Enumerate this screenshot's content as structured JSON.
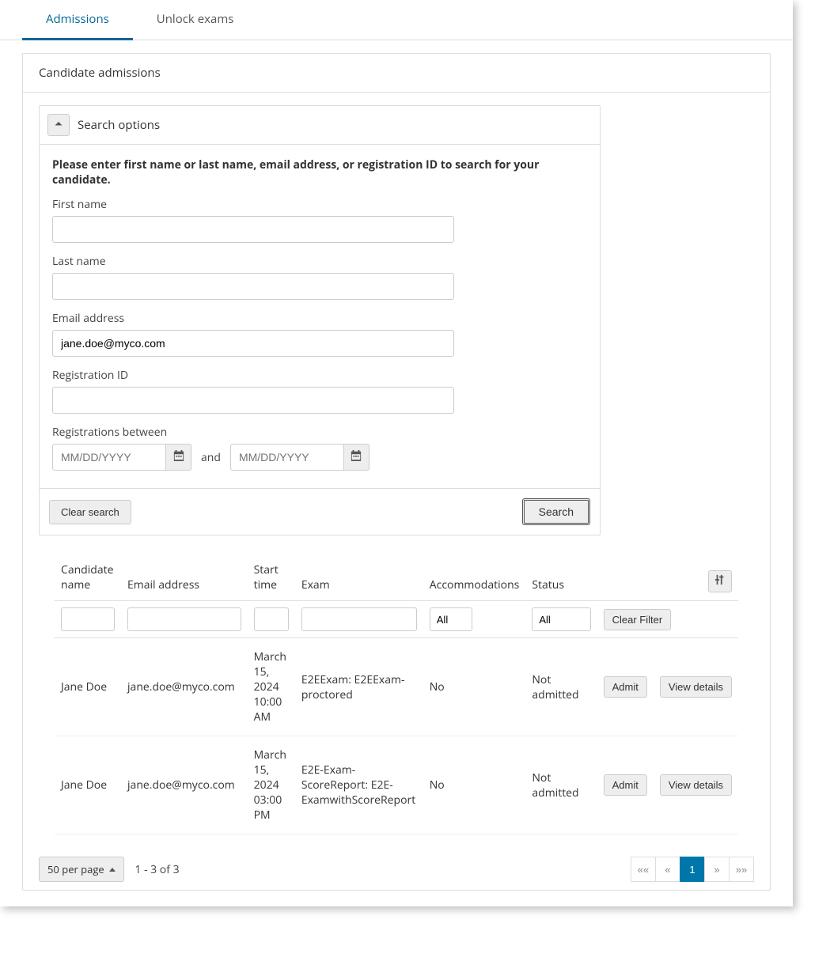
{
  "tabs": [
    {
      "label": "Admissions",
      "active": true
    },
    {
      "label": "Unlock exams",
      "active": false
    }
  ],
  "panel_title": "Candidate admissions",
  "search": {
    "title": "Search options",
    "instruction": "Please enter first name or last name, email address, or registration ID to search for your candidate.",
    "first_name_label": "First name",
    "first_name_value": "",
    "last_name_label": "Last name",
    "last_name_value": "",
    "email_label": "Email address",
    "email_value": "jane.doe@myco.com",
    "registration_id_label": "Registration ID",
    "registration_id_value": "",
    "between_label": "Registrations between",
    "date_placeholder": "MM/DD/YYYY",
    "and_label": "and",
    "clear_label": "Clear search",
    "search_label": "Search"
  },
  "table": {
    "headers": {
      "candidate_name": "Candidate name",
      "email": "Email address",
      "start_time": "Start time",
      "exam": "Exam",
      "accommodations": "Accommodations",
      "status": "Status"
    },
    "filters": {
      "accommodations": "All",
      "status": "All",
      "clear": "Clear Filter"
    },
    "action_labels": {
      "admit": "Admit",
      "view_details": "View details"
    },
    "rows": [
      {
        "name": "Jane Doe",
        "email": "jane.doe@myco.com",
        "start_time": "March 15, 2024 10:00 AM",
        "exam": "E2EExam: E2EExam-proctored",
        "accommodations": "No",
        "status": "Not admitted"
      },
      {
        "name": "Jane Doe",
        "email": "jane.doe@myco.com",
        "start_time": "March 15, 2024 03:00 PM",
        "exam": "E2E-Exam-ScoreReport: E2E-ExamwithScoreReport",
        "accommodations": "No",
        "status": "Not admitted"
      }
    ]
  },
  "footer": {
    "per_page": "50 per page",
    "count": "1 - 3 of 3",
    "pager": {
      "first": "««",
      "prev": "«",
      "page": "1",
      "next": "»",
      "last": "»»"
    }
  }
}
